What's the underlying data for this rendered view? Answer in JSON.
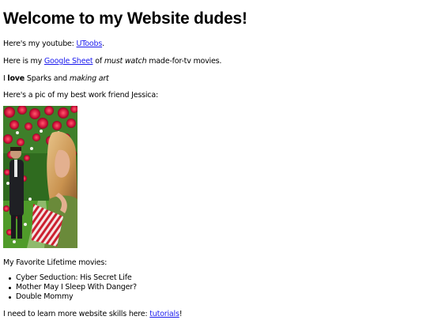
{
  "heading": "Welcome to my Website dudes!",
  "youtube": {
    "prefix": "Here's my youtube: ",
    "link_text": "UToobs",
    "suffix": "."
  },
  "sheet": {
    "prefix": "Here is my ",
    "link_text": "Google Sheet",
    "middle": " of ",
    "emphasis": "must watch",
    "suffix": " made-for-tv movies."
  },
  "love": {
    "prefix": "I ",
    "bold": "love",
    "middle": " Sparks and ",
    "italic": "making art"
  },
  "friend_caption": "Here's a pic of my best work friend Jessica:",
  "movies_heading": "My Favorite Lifetime movies:",
  "movies": [
    "Cyber Seduction: His Secret Life",
    "Mother May I Sleep With Danger?",
    "Double Mommy"
  ],
  "learn": {
    "prefix": "I need to learn more website skills here: ",
    "link_text": "tutorials",
    "suffix": "!"
  },
  "colors": {
    "link": "#1a1aee",
    "text": "#000000",
    "background": "#ffffff"
  }
}
